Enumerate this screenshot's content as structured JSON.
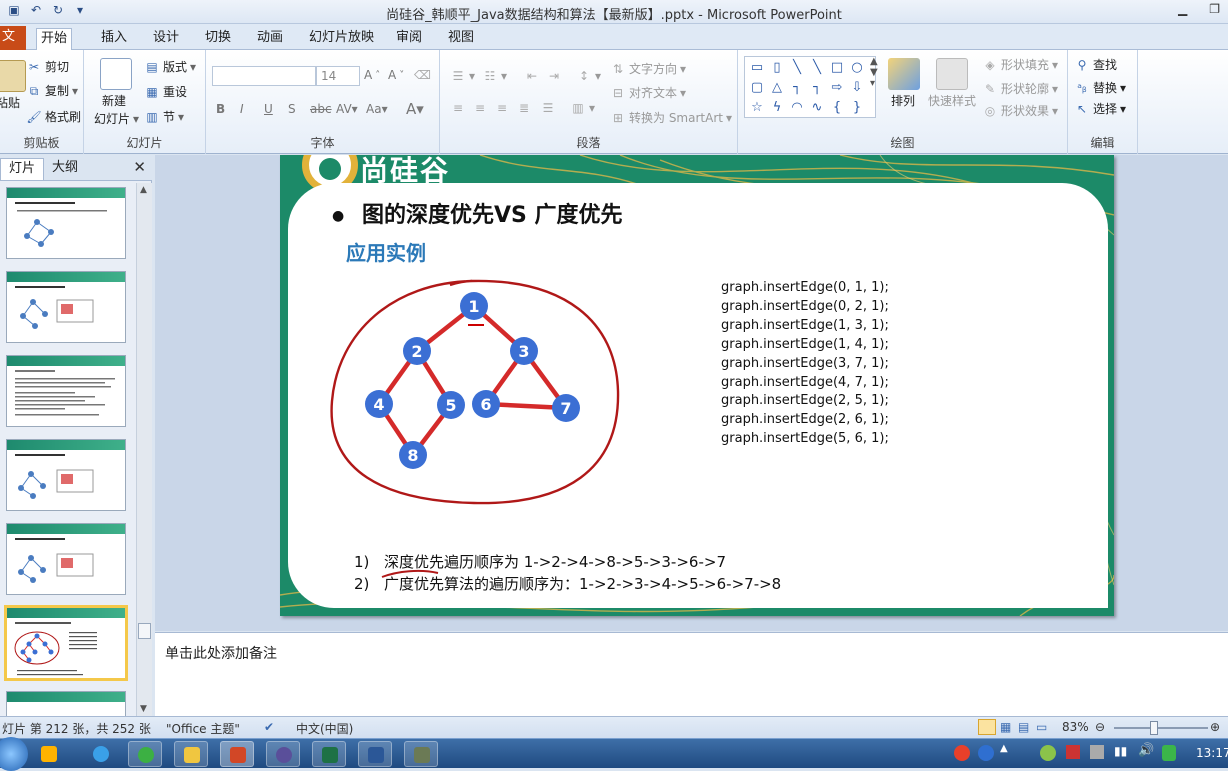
{
  "window": {
    "title": "尚硅谷_韩顺平_Java数据结构和算法【最新版】.pptx - Microsoft PowerPoint"
  },
  "qat": [
    "save-icon",
    "undo-icon",
    "redo-icon",
    "customize-icon"
  ],
  "tabs": [
    "文件",
    "开始",
    "插入",
    "设计",
    "切换",
    "动画",
    "幻灯片放映",
    "审阅",
    "视图"
  ],
  "ribbon": {
    "clipboard": {
      "paste": "粘贴",
      "cut": "剪切",
      "copy": "复制",
      "format_painter": "格式刷",
      "label": "剪贴板"
    },
    "slides": {
      "new_slide": "新建",
      "new_slide2": "幻灯片",
      "layout": "版式",
      "reset": "重设",
      "section": "节",
      "label": "幻灯片"
    },
    "font": {
      "font_name": "",
      "font_size": "14",
      "label": "字体"
    },
    "paragraph": {
      "text_direction": "文字方向",
      "align_text": "对齐文本",
      "smartart": "转换为 SmartArt",
      "label": "段落"
    },
    "drawing": {
      "arrange": "排列",
      "quick_styles": "快速样式",
      "shape_fill": "形状填充",
      "shape_outline": "形状轮廓",
      "shape_effects": "形状效果",
      "label": "绘图"
    },
    "editing": {
      "find": "查找",
      "replace": "替换",
      "select": "选择",
      "label": "编辑"
    }
  },
  "panel": {
    "tab_slides": "灯片",
    "tab_outline": "大纲"
  },
  "slide": {
    "logo_text": "尚硅谷",
    "title": "图的深度优先VS 广度优先",
    "subtitle": "应用实例",
    "code_lines": [
      "graph.insertEdge(0, 1, 1);",
      "graph.insertEdge(0, 2, 1);",
      "graph.insertEdge(1, 3, 1);",
      "graph.insertEdge(1, 4, 1);",
      "graph.insertEdge(3, 7, 1);",
      "graph.insertEdge(4, 7, 1);",
      "graph.insertEdge(2, 5, 1);",
      "graph.insertEdge(2, 6, 1);",
      "graph.insertEdge(5, 6, 1);"
    ],
    "nodes": [
      "1",
      "2",
      "3",
      "4",
      "5",
      "6",
      "7",
      "8"
    ],
    "list": [
      {
        "num": "1)",
        "text": "深度优先遍历顺序为 1->2->4->8->5->3->6->7"
      },
      {
        "num": "2)",
        "text": "广度优先算法的遍历顺序为：1->2->3->4->5->6->7->8"
      }
    ]
  },
  "notes": {
    "placeholder": "单击此处添加备注"
  },
  "status": {
    "slide_info": "灯片 第 212 张，共 252 张",
    "theme": "\"Office 主题\"",
    "language": "中文(中国)",
    "zoom": "83%"
  },
  "taskbar": {
    "time": "13:17"
  },
  "colors": {
    "node": "#3b6fd4",
    "edge": "#d42a2a",
    "circle": "#b01818",
    "slide_green": "#1c8a68",
    "subtitle": "#2b79b8"
  }
}
